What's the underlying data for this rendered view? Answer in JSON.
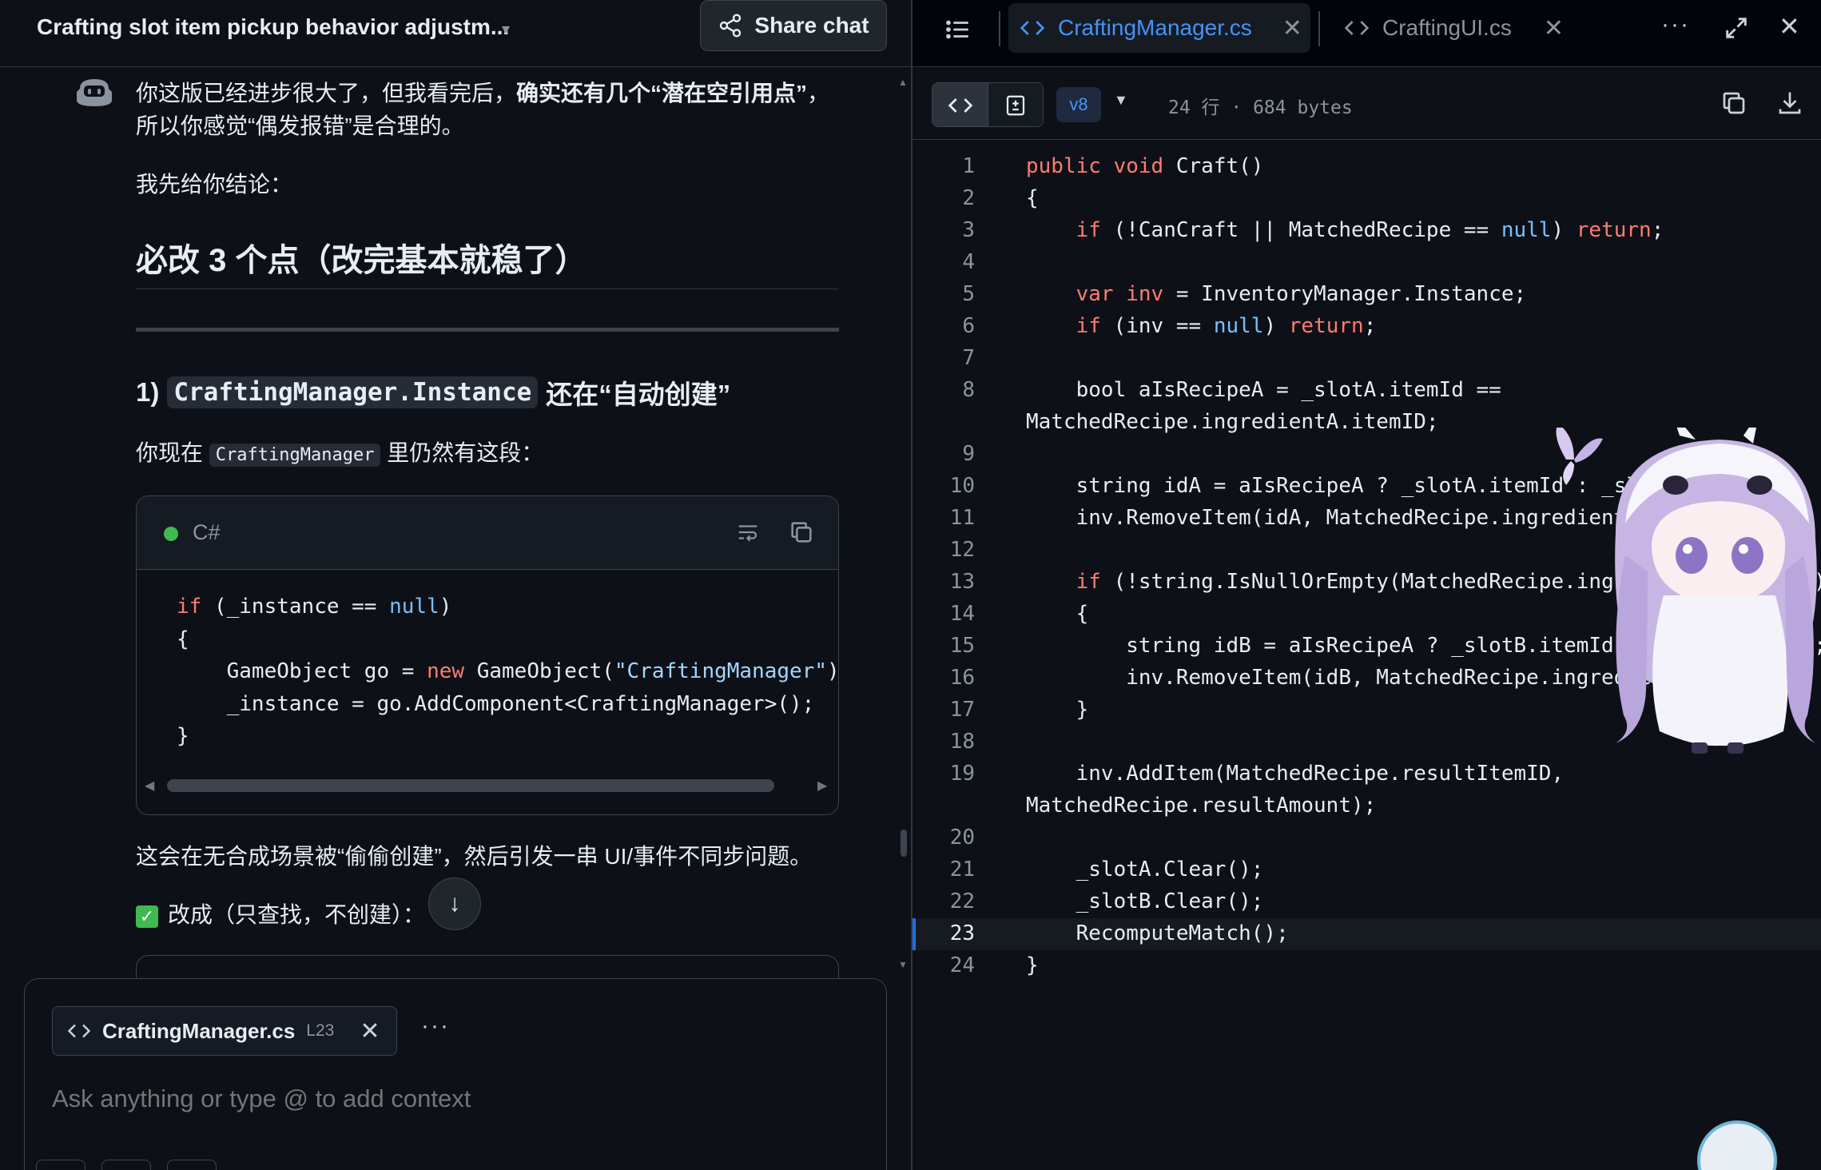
{
  "chat": {
    "title": "Crafting slot item pickup behavior adjustm...",
    "share_label": "Share chat",
    "para1_line1_a": "你这版已经进步很大了，但我看完后，",
    "para1_line1_b": "确实还有几个“潜在空引用点”",
    "para1_line1_c": "，",
    "para1_line2": "所以你感觉“偶发报错”是合理的。",
    "para2": "我先给你结论：",
    "heading": "必改 3 个点（改完基本就稳了）",
    "subheading_prefix": "1)",
    "subheading_code": "CraftingManager.Instance",
    "subheading_suffix": "还在“自动创建”",
    "para3_a": "你现在",
    "para3_code": "CraftingManager",
    "para3_b": "里仍然有这段：",
    "code_lang": "C#",
    "para4": "这会在无合成场景被“偷偷创建”，然后引发一串 UI/事件不同步问题。",
    "para5": "改成（只查找，不创建）："
  },
  "composer": {
    "chip_name": "CraftingManager.cs",
    "chip_line": "L23",
    "placeholder": "Ask anything or type @ to add context"
  },
  "editor": {
    "tab_active": "CraftingManager.cs",
    "tab_2": "CraftingUI.cs",
    "version": "v8",
    "meta": "24 行 · 684 bytes",
    "current_line": 23,
    "line_numbers": [
      "1",
      "2",
      "3",
      "4",
      "5",
      "6",
      "7",
      "8",
      "9",
      "10",
      "11",
      "12",
      "13",
      "14",
      "15",
      "16",
      "17",
      "18",
      "19",
      "20",
      "21",
      "22",
      "23",
      "24"
    ]
  },
  "colors": {
    "keyword": "#ff7b72",
    "literal": "#79c0ff",
    "string": "#a5d6ff",
    "accent": "#4493f8",
    "success": "#3fb950"
  }
}
